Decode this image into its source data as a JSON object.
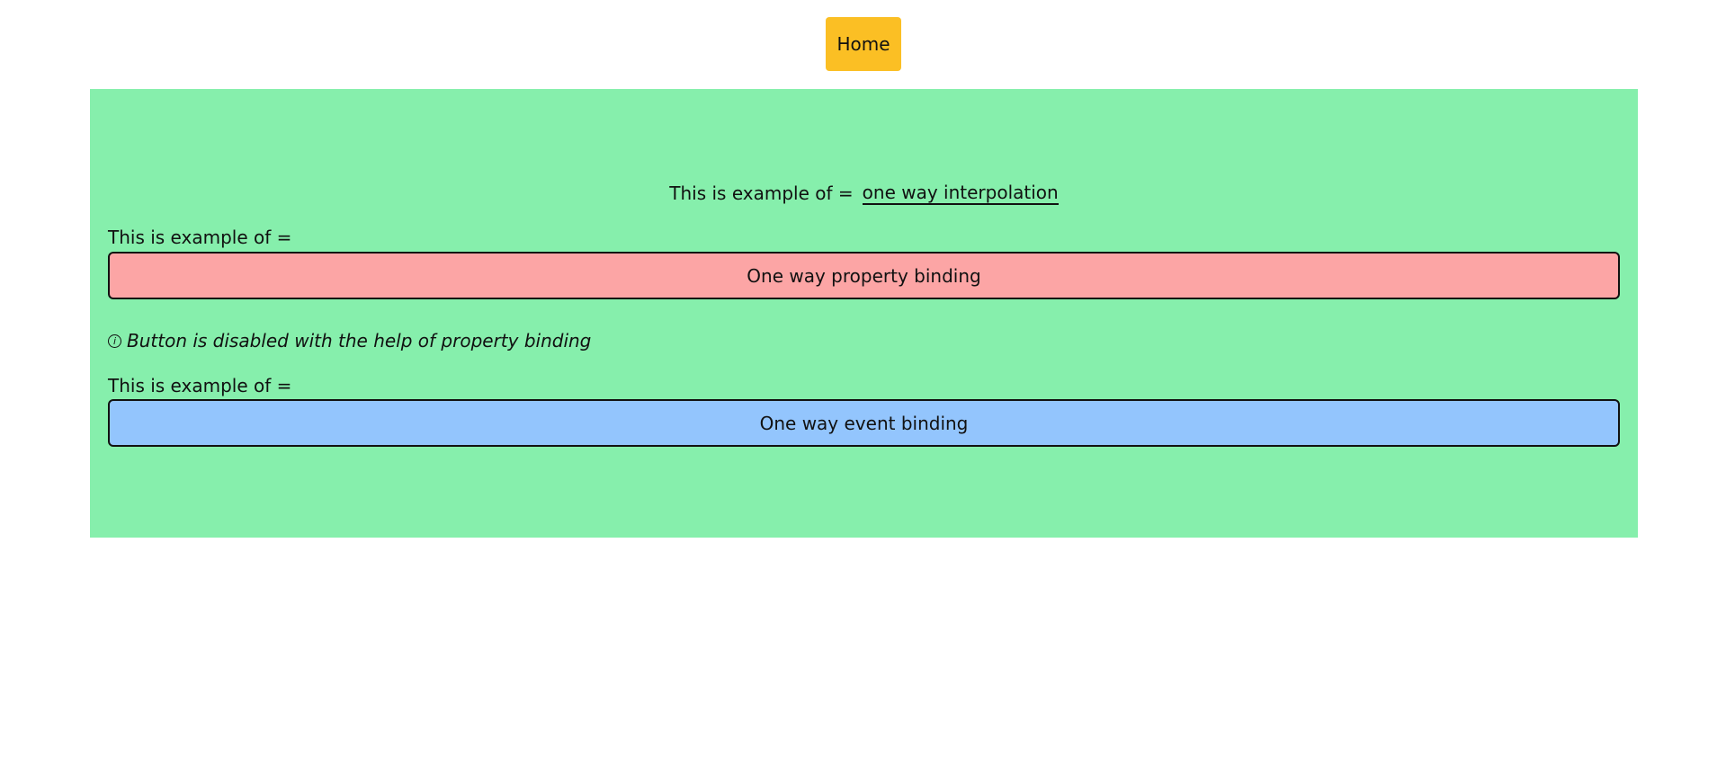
{
  "nav": {
    "home_label": "Home",
    "home_color": "#fbbf24"
  },
  "panel": {
    "background": "#86efac",
    "interpolation": {
      "prefix": "This is example of =",
      "value": "one way interpolation"
    },
    "property_binding": {
      "label": "This is example of =",
      "button_label": "One way property binding",
      "disabled": true,
      "button_color": "#fca5a5"
    },
    "note": {
      "icon": "info-icon",
      "text": "Button is disabled with the help of property binding"
    },
    "event_binding": {
      "label": "This is example of =",
      "button_label": "One way event binding",
      "button_color": "#93c5fd"
    }
  }
}
